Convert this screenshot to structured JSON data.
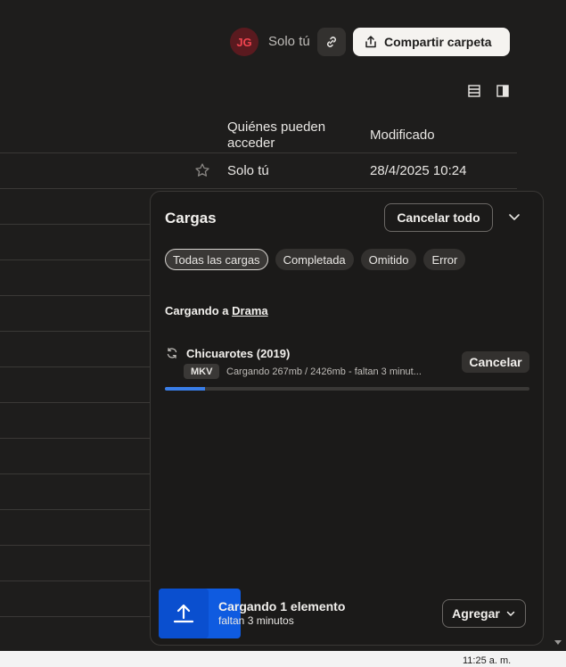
{
  "header": {
    "avatar_initials": "JG",
    "access_label": "Solo tú",
    "share_label": "Compartir carpeta"
  },
  "table": {
    "columns": {
      "access": "Quiénes pueden acceder",
      "modified": "Modificado"
    },
    "rows": [
      {
        "access": "Solo tú",
        "modified": "28/4/2025 10:24"
      }
    ]
  },
  "uploads": {
    "title": "Cargas",
    "cancel_all_label": "Cancelar todo",
    "filters": [
      "Todas las cargas",
      "Completada",
      "Omitido",
      "Error"
    ],
    "active_filter": "Todas las cargas",
    "destination_prefix": "Cargando a",
    "destination_folder": "Drama",
    "items": [
      {
        "name": "Chicuarotes (2019)",
        "type": "MKV",
        "status_text": "Cargando 267mb / 2426mb - faltan 3 minut...",
        "cancel_label": "Cancelar",
        "progress": 0.11
      }
    ],
    "footer": {
      "title": "Cargando 1 elemento",
      "subtitle": "faltan 3 minutos",
      "add_label": "Agregar"
    }
  },
  "taskbar": {
    "clock": "11:25 a. m."
  },
  "colors": {
    "accent": "#0f5be0",
    "progress": "#3a7ee8",
    "avatar_bg": "#5a1a1f",
    "avatar_text": "#f0444f"
  }
}
